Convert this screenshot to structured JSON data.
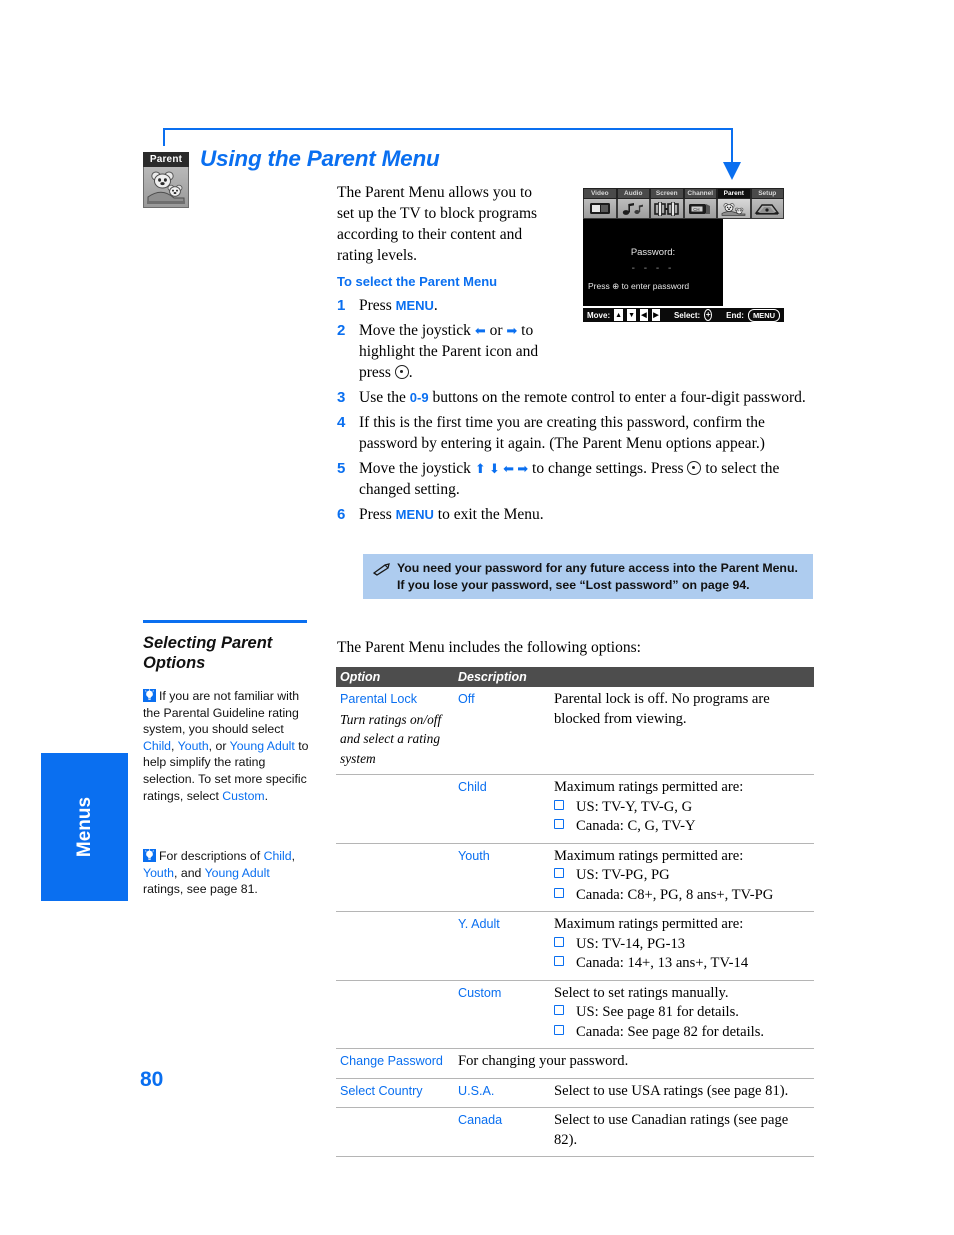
{
  "colors": {
    "accent": "#0a6ff0",
    "note_bg": "#aeccef",
    "table_header_bg": "#4d4d4d"
  },
  "chapter_icon": {
    "label": "Parent",
    "icon": "koala-bear-parent-icon"
  },
  "header": {
    "title": "Using the Parent Menu"
  },
  "intro": "The Parent Menu allows you to set up the TV to block programs according to their content and rating levels.",
  "tv_graphic": {
    "tabs": [
      {
        "label": "Video",
        "icon": "video-icon",
        "selected": false
      },
      {
        "label": "Audio",
        "icon": "audio-note-icon",
        "selected": false
      },
      {
        "label": "Screen",
        "icon": "screen-icon",
        "selected": false
      },
      {
        "label": "Channel",
        "icon": "channel-icon",
        "selected": false
      },
      {
        "label": "Parent",
        "icon": "parent-koala-icon",
        "selected": true
      },
      {
        "label": "Setup",
        "icon": "setup-icon",
        "selected": false
      }
    ],
    "password_label": "Password:",
    "password_dashes": "- - - -",
    "press_hint": "Press ⊕ to enter password",
    "bottom_bar": {
      "move_label": "Move:",
      "select_label": "Select:",
      "end_label": "End:",
      "end_key": "MENU"
    }
  },
  "steps": {
    "heading": "To select the Parent Menu",
    "items": [
      {
        "num": "1",
        "text_parts": [
          "Press ",
          "MENU",
          "."
        ]
      },
      {
        "num": "2",
        "text_parts": [
          "Move the joystick ",
          "←",
          " or ",
          "→",
          " to highlight the Parent icon and press ",
          "⊕",
          "."
        ]
      },
      {
        "num": "3",
        "text_parts": [
          "Use the ",
          "0-9",
          " buttons on the remote control to enter a four-digit password."
        ]
      },
      {
        "num": "4",
        "text_parts": [
          "If this is the first time you are creating this password, confirm the password by entering it again. (The Parent Menu options appear.)"
        ]
      },
      {
        "num": "5",
        "text_parts": [
          "Move the joystick ",
          "↑ ↓ ← →",
          " to change settings. Press ",
          "⊕",
          " to select the changed setting."
        ]
      },
      {
        "num": "6",
        "text_parts": [
          "Press ",
          "MENU",
          " to exit the Menu."
        ]
      }
    ],
    "step1_pre": "Press ",
    "step1_key": "MENU",
    "step1_post": ".",
    "step2_a": "Move the joystick ",
    "step2_b": " or ",
    "step2_c": " to highlight the Parent icon and press ",
    "step2_d": ".",
    "step3_a": "Use the ",
    "step3_key": "0-9",
    "step3_b": " buttons on the remote control to enter a four-digit password.",
    "step4": "If this is the first time you are creating this password, confirm the password by entering it again. (The Parent Menu options appear.)",
    "step5_a": "Move the joystick ",
    "step5_b": " to change settings. Press ",
    "step5_c": " to select the changed setting.",
    "step6_a": "Press ",
    "step6_key": "MENU",
    "step6_b": " to exit the Menu."
  },
  "note": {
    "icon": "pencil-note-icon",
    "text": "You need your password for any future access into the Parent Menu. If you lose your password, see “Lost password” on page 94."
  },
  "left_column": {
    "subheading": "Selecting Parent Options",
    "tip1": {
      "icon": "lightbulb-tip-icon",
      "a": "If you are not familiar with the Parental Guideline rating system, you should select ",
      "link1": "Child",
      "b": ", ",
      "link2": "Youth",
      "c": ", or ",
      "link3": "Young Adult",
      "d": " to help simplify the rating selection. To set more specific ratings, select ",
      "link4": "Custom",
      "e": "."
    },
    "tip2": {
      "icon": "lightbulb-tip-icon",
      "a": "For descriptions of ",
      "link1": "Child",
      "b": ", ",
      "link2": "Youth",
      "c": ", and ",
      "link3": "Young Adult",
      "d": " ratings, see page 81."
    },
    "side_tab_label": "Menus",
    "page_number": "80"
  },
  "table": {
    "intro": "The Parent Menu includes the following options:",
    "headers": {
      "option": "Option",
      "description": "Description"
    },
    "rows": [
      {
        "option": "Parental Lock",
        "option_desc": "Turn ratings on/off and select a rating system",
        "value": "Off",
        "desc": "Parental lock is off. No programs are blocked from viewing.",
        "bullets": []
      },
      {
        "option": "",
        "option_desc": "",
        "value": "Child",
        "desc": "Maximum ratings permitted are:",
        "bullets": [
          "US: TV-Y, TV-G, G",
          "Canada: C, G, TV-Y"
        ]
      },
      {
        "option": "",
        "option_desc": "",
        "value": "Youth",
        "desc": "Maximum ratings permitted are:",
        "bullets": [
          "US: TV-PG, PG",
          "Canada: C8+, PG, 8 ans+, TV-PG"
        ]
      },
      {
        "option": "",
        "option_desc": "",
        "value": "Y. Adult",
        "desc": "Maximum ratings permitted are:",
        "bullets": [
          "US: TV-14, PG-13",
          "Canada: 14+, 13 ans+, TV-14"
        ]
      },
      {
        "option": "",
        "option_desc": "",
        "value": "Custom",
        "desc": "Select to set ratings manually.",
        "bullets": [
          "US: See page 81 for details.",
          "Canada: See page 82 for details."
        ]
      },
      {
        "option": "Change Password",
        "option_desc": "",
        "value": "",
        "desc": "For changing your password.",
        "bullets": []
      },
      {
        "option": "Select Country",
        "option_desc": "",
        "value": "U.S.A.",
        "desc": "Select to use USA ratings (see page 81).",
        "bullets": []
      },
      {
        "option": "",
        "option_desc": "",
        "value": "Canada",
        "desc": "Select to use Canadian ratings (see page 82).",
        "bullets": []
      }
    ]
  }
}
